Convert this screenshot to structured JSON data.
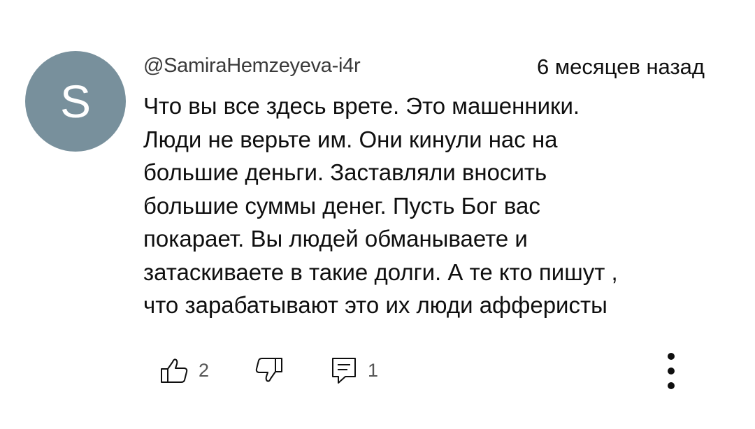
{
  "comment": {
    "avatar_letter": "S",
    "author": "@SamiraHemzeyeva-i4r",
    "timestamp": "6 месяцев назад",
    "lines": [
      "Что вы все здесь врете. Это машенники.",
      "Люди не верьте им. Они кинули нас на",
      "большие деньги. Заставляли вносить",
      "большие суммы денег. Пусть Бог вас",
      "покарает. Вы людей обманываете и",
      "затаскиваете в такие долги. А те кто пишут ,",
      "что зарабатывают это их люди афферисты"
    ]
  },
  "actions": {
    "like_icon": "thumbs-up-icon",
    "like_count": "2",
    "dislike_icon": "thumbs-down-icon",
    "reply_icon": "reply-icon",
    "reply_count": "1",
    "more_icon": "more-vertical-icon"
  },
  "colors": {
    "avatar_bg": "#78909c",
    "text": "#0f0f0f",
    "secondary_text": "#555555"
  }
}
